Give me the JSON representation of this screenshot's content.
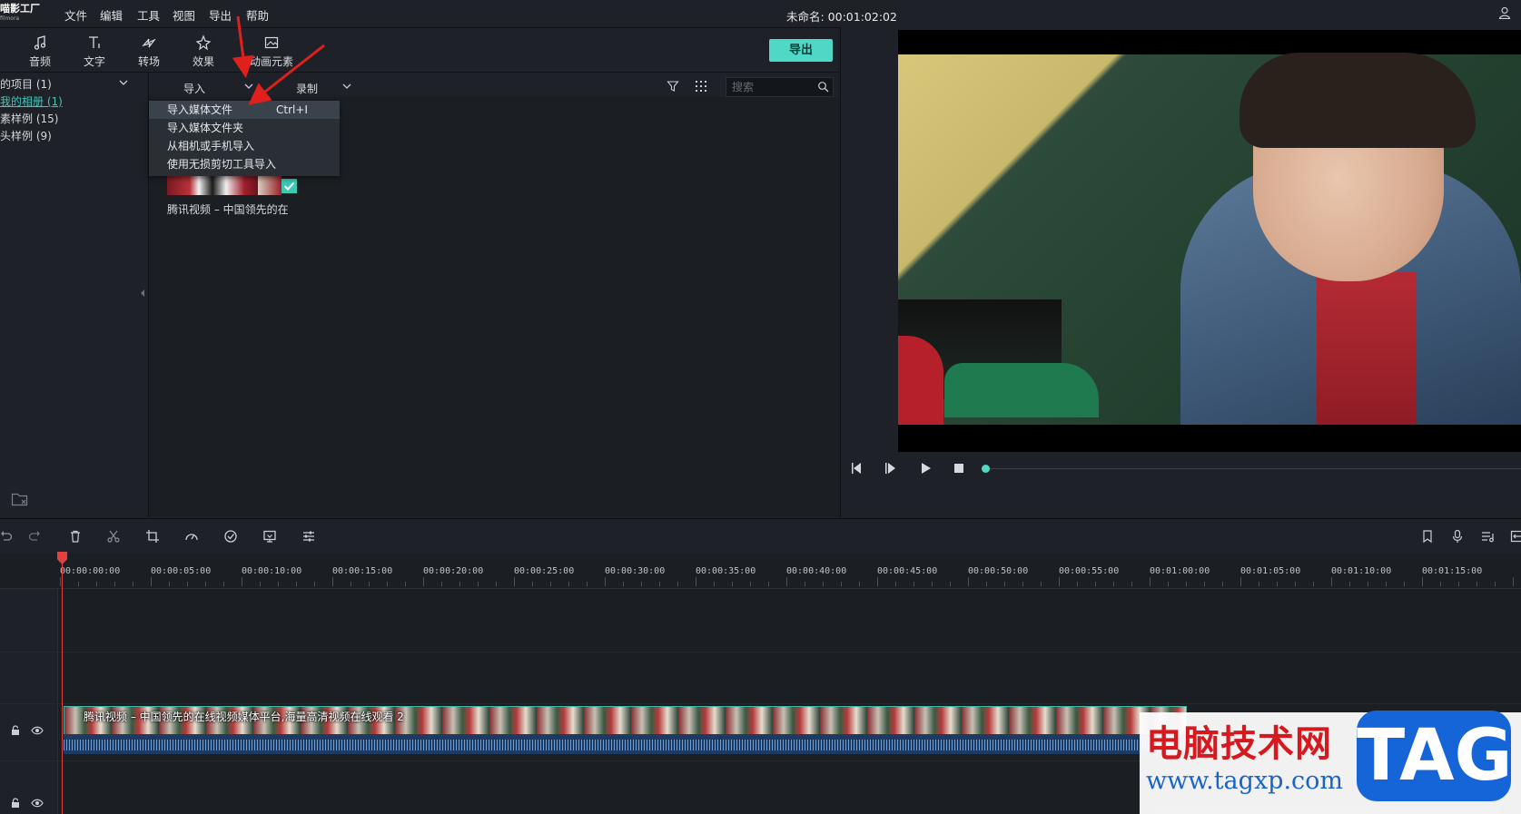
{
  "app": {
    "logo": "喵影工厂",
    "logo_sub": "filmora",
    "menu": [
      "文件",
      "编辑",
      "工具",
      "视图",
      "导出",
      "帮助"
    ],
    "project_title": "未命名: 00:01:02:02"
  },
  "toolbar": {
    "tools": [
      {
        "label": "音频",
        "icon": "music-note-icon"
      },
      {
        "label": "文字",
        "icon": "text-icon"
      },
      {
        "label": "转场",
        "icon": "transition-icon"
      },
      {
        "label": "效果",
        "icon": "effects-icon"
      },
      {
        "label": "动画元素",
        "icon": "image-icon"
      }
    ],
    "export_label": "导出"
  },
  "left_panel": {
    "items": [
      "的项目 (1)",
      "我的相册 (1)",
      "素样例 (15)",
      "头样例 (9)"
    ]
  },
  "media_bar": {
    "import_label": "导入",
    "record_label": "录制",
    "search_placeholder": "搜索"
  },
  "import_menu": {
    "items": [
      {
        "label": "导入媒体文件",
        "shortcut": "Ctrl+I"
      },
      {
        "label": "导入媒体文件夹",
        "shortcut": ""
      },
      {
        "label": "从相机或手机导入",
        "shortcut": ""
      },
      {
        "label": "使用无损剪切工具导入",
        "shortcut": ""
      }
    ]
  },
  "media": {
    "clip_name": "腾讯视频 – 中国领先的在"
  },
  "timeline": {
    "ruler": [
      "00:00:00:00",
      "00:00:05:00",
      "00:00:10:00",
      "00:00:15:00",
      "00:00:20:00",
      "00:00:25:00",
      "00:00:30:00",
      "00:00:35:00",
      "00:00:40:00",
      "00:00:45:00",
      "00:00:50:00",
      "00:00:55:00",
      "00:01:00:00",
      "00:01:05:00",
      "00:01:10:00",
      "00:01:15:00"
    ],
    "clip_title": "腾讯视频 – 中国领先的在线视频媒体平台,海量高清视频在线观看 2"
  },
  "watermark": {
    "cn": "电脑技术网",
    "url": "www.tagxp.com",
    "tag": "TAG"
  },
  "colors": {
    "accent": "#4fd8c5",
    "playhead": "#e34040",
    "annotation_arrow": "#e0201c"
  }
}
